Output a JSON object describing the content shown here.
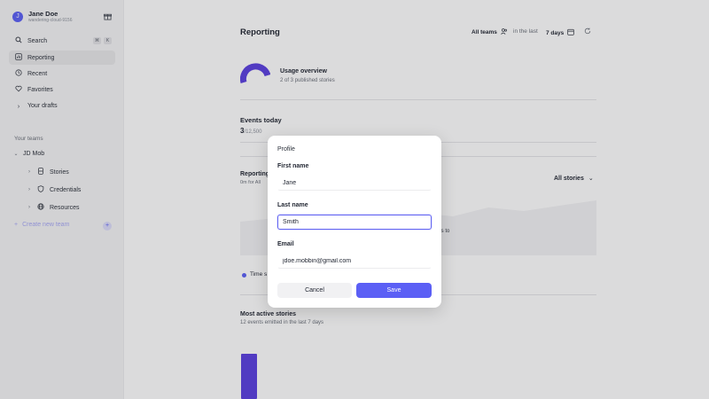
{
  "user": {
    "initial": "J",
    "name": "Jane Doe",
    "handle": "wandering-cloud-9156"
  },
  "sidebar": {
    "search_label": "Search",
    "search_keys": [
      "⌘",
      "K"
    ],
    "items": [
      {
        "label": "Reporting",
        "icon": "chart-icon"
      },
      {
        "label": "Recent",
        "icon": "clock-icon"
      },
      {
        "label": "Favorites",
        "icon": "heart-icon"
      },
      {
        "label": "Your drafts",
        "icon": "chevron-right-icon"
      }
    ],
    "teams_label": "Your teams",
    "team": {
      "name": "JD Mob",
      "children": [
        {
          "label": "Stories",
          "icon": "stories-icon"
        },
        {
          "label": "Credentials",
          "icon": "shield-icon"
        },
        {
          "label": "Resources",
          "icon": "globe-icon"
        }
      ]
    },
    "create_team_label": "Create new team"
  },
  "header": {
    "title": "Reporting",
    "team_filter": "All teams",
    "period_prefix": "in the last",
    "period_value": "7 days"
  },
  "usage": {
    "title": "Usage overview",
    "subtitle": "2 of 3 published stories"
  },
  "events": {
    "title": "Events today",
    "value": "3",
    "limit": "/12,500"
  },
  "reporting_section": {
    "title": "Reporting",
    "subtitle": "0m for All",
    "stories_filter": "All stories",
    "hint_line1": "y",
    "hint_line2": "tions to",
    "legend_label": "Time s"
  },
  "most_active": {
    "title": "Most active stories",
    "subtitle": "12 events emitted in the last 7 days"
  },
  "modal": {
    "title": "Profile",
    "first_name_label": "First name",
    "first_name_value": "Jane",
    "last_name_label": "Last name",
    "last_name_value": "Smith",
    "email_label": "Email",
    "email_value": "jdoe.mobbin@gmail.com",
    "cancel_label": "Cancel",
    "save_label": "Save"
  },
  "colors": {
    "accent": "#5b5ff5",
    "bar": "#5a3fe0",
    "focus": "#6163f2"
  }
}
